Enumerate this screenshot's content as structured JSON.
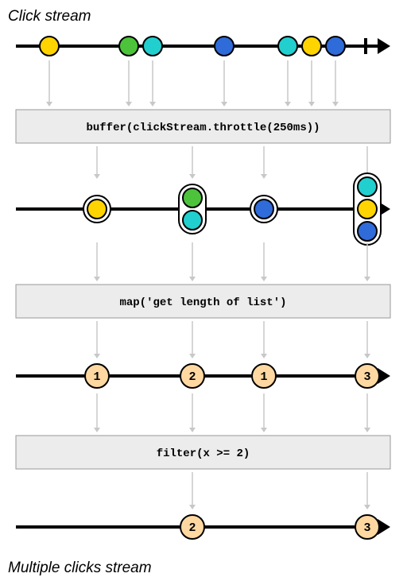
{
  "titleTop": "Click stream",
  "titleBottom": "Multiple clicks stream",
  "op1": "buffer(clickStream.throttle(250ms))",
  "op2": "map('get length of list')",
  "op3": "filter(x >= 2)",
  "colors": {
    "yellow": "#ffd400",
    "green": "#4cc33b",
    "cyan": "#22cfcf",
    "blue": "#2f6bd9",
    "tan": "#ffd8a1",
    "box": "#ececec",
    "arrow": "#c8c8c8"
  },
  "chart_data": {
    "type": "scatter",
    "xlim": [
      0,
      440
    ],
    "timeline1": [
      {
        "x": 40,
        "color": "yellow"
      },
      {
        "x": 140,
        "color": "green"
      },
      {
        "x": 170,
        "color": "cyan"
      },
      {
        "x": 260,
        "color": "blue"
      },
      {
        "x": 340,
        "color": "cyan"
      },
      {
        "x": 370,
        "color": "yellow"
      },
      {
        "x": 400,
        "color": "blue"
      }
    ],
    "timeline2_groups": [
      {
        "x": 100,
        "items": [
          "yellow"
        ]
      },
      {
        "x": 220,
        "items": [
          "green",
          "cyan"
        ]
      },
      {
        "x": 310,
        "items": [
          "blue"
        ]
      },
      {
        "x": 440,
        "items": [
          "cyan",
          "yellow",
          "blue"
        ]
      }
    ],
    "timeline3": [
      {
        "x": 100,
        "n": 1
      },
      {
        "x": 220,
        "n": 2
      },
      {
        "x": 310,
        "n": 1
      },
      {
        "x": 440,
        "n": 3
      }
    ],
    "timeline4": [
      {
        "x": 220,
        "n": 2
      },
      {
        "x": 440,
        "n": 3
      }
    ],
    "arrows_t1_to_op1": [
      40,
      140,
      170,
      260,
      340,
      370,
      400
    ],
    "arrows_op1_to_t2": [
      100,
      220,
      310,
      440
    ],
    "arrows_t2_to_op2": [
      100,
      220,
      310,
      440
    ],
    "arrows_op2_to_t3": [
      100,
      220,
      310,
      440
    ],
    "arrows_t3_to_op3": [
      100,
      220,
      310,
      440
    ],
    "arrows_op3_to_t4": [
      220,
      440
    ]
  }
}
